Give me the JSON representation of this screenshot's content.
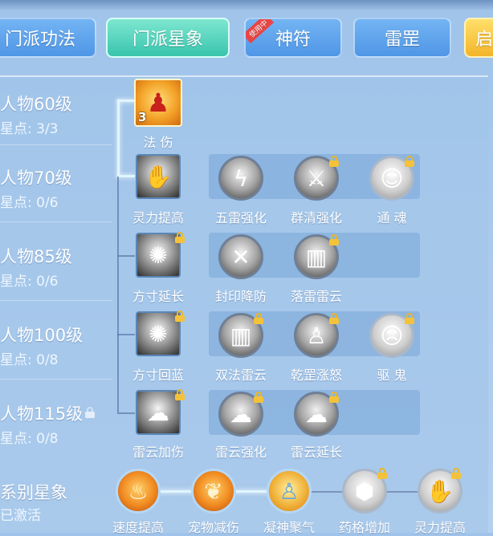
{
  "tabs": [
    {
      "label": "门派功法"
    },
    {
      "label": "门派星象"
    },
    {
      "label": "神符",
      "ribbon": "使用中"
    },
    {
      "label": "雷罡"
    },
    {
      "label": "启"
    }
  ],
  "tiers": [
    {
      "level": "人物60级",
      "points": "星点: 3/3"
    },
    {
      "level": "人物70级",
      "points": "星点: 0/6"
    },
    {
      "level": "人物85级",
      "points": "星点: 0/6"
    },
    {
      "level": "人物100级",
      "points": "星点: 0/8"
    },
    {
      "level": "人物115级",
      "points": "星点: 0/8"
    }
  ],
  "skills": {
    "fashang": {
      "label": "法 伤",
      "count": "3"
    },
    "row70": {
      "main": "灵力提高",
      "subs": [
        "五雷强化",
        "群清强化",
        "通 魂"
      ]
    },
    "row85": {
      "main": "方寸延长",
      "subs": [
        "封印降防",
        "落雷雷云"
      ]
    },
    "row100": {
      "main": "方寸回蓝",
      "subs": [
        "双法雷云",
        "乾罡涨怒",
        "驱 鬼"
      ]
    },
    "row115": {
      "main": "雷云加伤",
      "subs": [
        "雷云强化",
        "雷云延长"
      ]
    }
  },
  "series": {
    "title": "系别星象",
    "status": "已激活",
    "items": [
      "速度提高",
      "宠物减伤",
      "凝神聚气",
      "药格增加",
      "灵力提高"
    ]
  },
  "colors": {
    "accent_tab": "#38c4ae",
    "tab_blue": "#4f96e6",
    "lock": "#f4c23a"
  }
}
